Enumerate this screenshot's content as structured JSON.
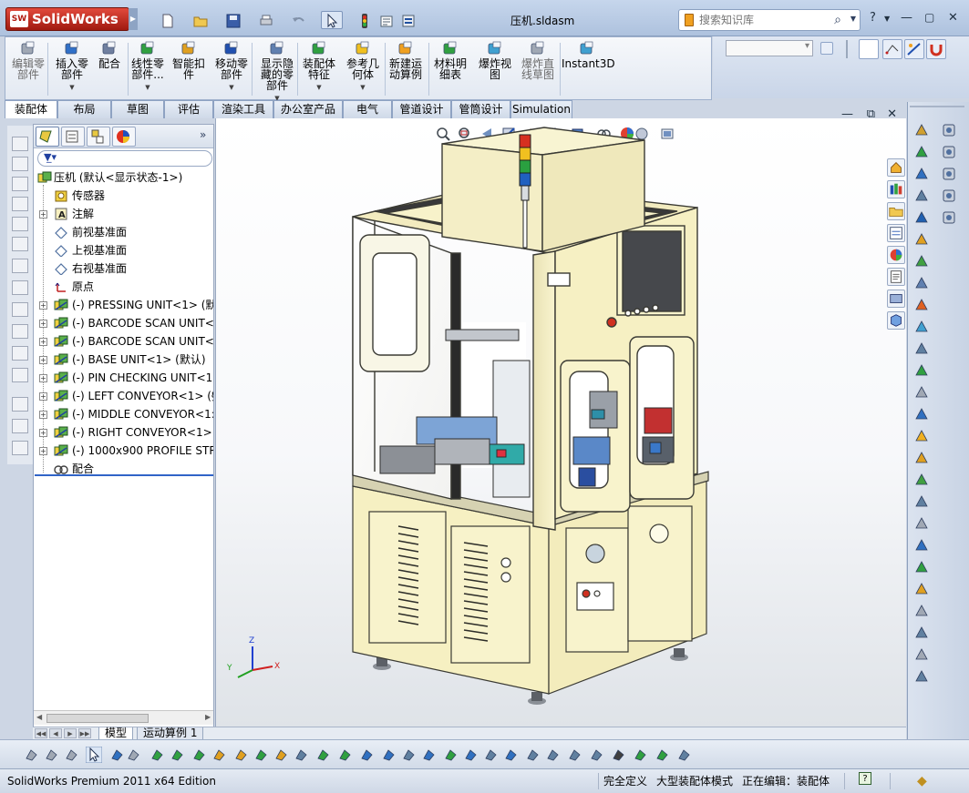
{
  "app": {
    "logo_text": "SolidWorks",
    "logo_badge": "SW",
    "document_title": "压机.sldasm",
    "search_placeholder": "搜索知识库",
    "help_label": "?",
    "minimize": "—",
    "close": "✕"
  },
  "command_manager": {
    "items": [
      {
        "label": "编辑零\n部件",
        "icon": "edit-component-icon",
        "dim": true
      },
      {
        "label": "插入零\n部件",
        "icon": "insert-component-icon",
        "dim": false
      },
      {
        "label": "配合",
        "icon": "mate-icon",
        "dim": false
      },
      {
        "label": "线性零\n部件...",
        "icon": "linear-pattern-icon",
        "dim": false
      },
      {
        "label": "智能扣\n件",
        "icon": "smart-fasteners-icon",
        "dim": false
      },
      {
        "label": "移动零\n部件",
        "icon": "move-component-icon",
        "dim": false
      },
      {
        "label": "显示隐\n藏的零\n部件",
        "icon": "show-hidden-icon",
        "dim": false
      },
      {
        "label": "装配体\n特征",
        "icon": "assembly-feature-icon",
        "dim": false
      },
      {
        "label": "参考几\n何体",
        "icon": "reference-geometry-icon",
        "dim": false
      },
      {
        "label": "新建运\n动算例",
        "icon": "motion-study-icon",
        "dim": false
      },
      {
        "label": "材料明\n细表",
        "icon": "bom-icon",
        "dim": false
      },
      {
        "label": "爆炸视\n图",
        "icon": "exploded-view-icon",
        "dim": false
      },
      {
        "label": "爆炸直\n线草图",
        "icon": "explode-line-icon",
        "dim": true
      },
      {
        "label": "Instant3D",
        "icon": "instant3d-icon",
        "dim": false
      }
    ]
  },
  "tabs": [
    "装配体",
    "布局",
    "草图",
    "评估",
    "渲染工具",
    "办公室产品",
    "电气",
    "管道设计",
    "管筒设计",
    "Simulation"
  ],
  "active_tab": "装配体",
  "feature_tree": {
    "root": "压机 (默认<显示状态-1>)",
    "items": [
      {
        "label": "传感器",
        "icon": "sensor-icon",
        "expand": false
      },
      {
        "label": "注解",
        "icon": "annotation-icon",
        "expand": true
      },
      {
        "label": "前视基准面",
        "icon": "plane-icon",
        "expand": false
      },
      {
        "label": "上视基准面",
        "icon": "plane-icon",
        "expand": false
      },
      {
        "label": "右视基准面",
        "icon": "plane-icon",
        "expand": false
      },
      {
        "label": "原点",
        "icon": "origin-icon",
        "expand": false
      },
      {
        "label": "(-) PRESSING UNIT<1> (默",
        "icon": "subassembly-icon",
        "expand": true
      },
      {
        "label": "(-) BARCODE SCAN UNIT<",
        "icon": "subassembly-icon",
        "expand": true
      },
      {
        "label": "(-) BARCODE SCAN UNIT<",
        "icon": "subassembly-icon",
        "expand": true
      },
      {
        "label": "(-) BASE UNIT<1> (默认)",
        "icon": "subassembly-icon",
        "expand": true
      },
      {
        "label": "(-) PIN CHECKING UNIT<1",
        "icon": "subassembly-icon",
        "expand": true
      },
      {
        "label": "(-) LEFT CONVEYOR<1> (§",
        "icon": "subassembly-icon",
        "expand": true
      },
      {
        "label": "(-) MIDDLE CONVEYOR<1:",
        "icon": "subassembly-icon",
        "expand": true
      },
      {
        "label": "(-) RIGHT CONVEYOR<1> ",
        "icon": "subassembly-icon",
        "expand": true
      },
      {
        "label": "(-) 1000x900 PROFILE STRU",
        "icon": "subassembly-icon",
        "expand": true
      },
      {
        "label": "配合",
        "icon": "mates-folder-icon",
        "expand": false
      }
    ]
  },
  "model_tabs": [
    "模型",
    "运动算例 1"
  ],
  "status": {
    "edition": "SolidWorks Premium 2011 x64 Edition",
    "definition": "完全定义",
    "mode": "大型装配体模式",
    "editing": "正在编辑：装配体"
  },
  "colors": {
    "accent": "#3064c8",
    "machine_body": "#f7f1c4",
    "machine_outline": "#3a3a34"
  }
}
